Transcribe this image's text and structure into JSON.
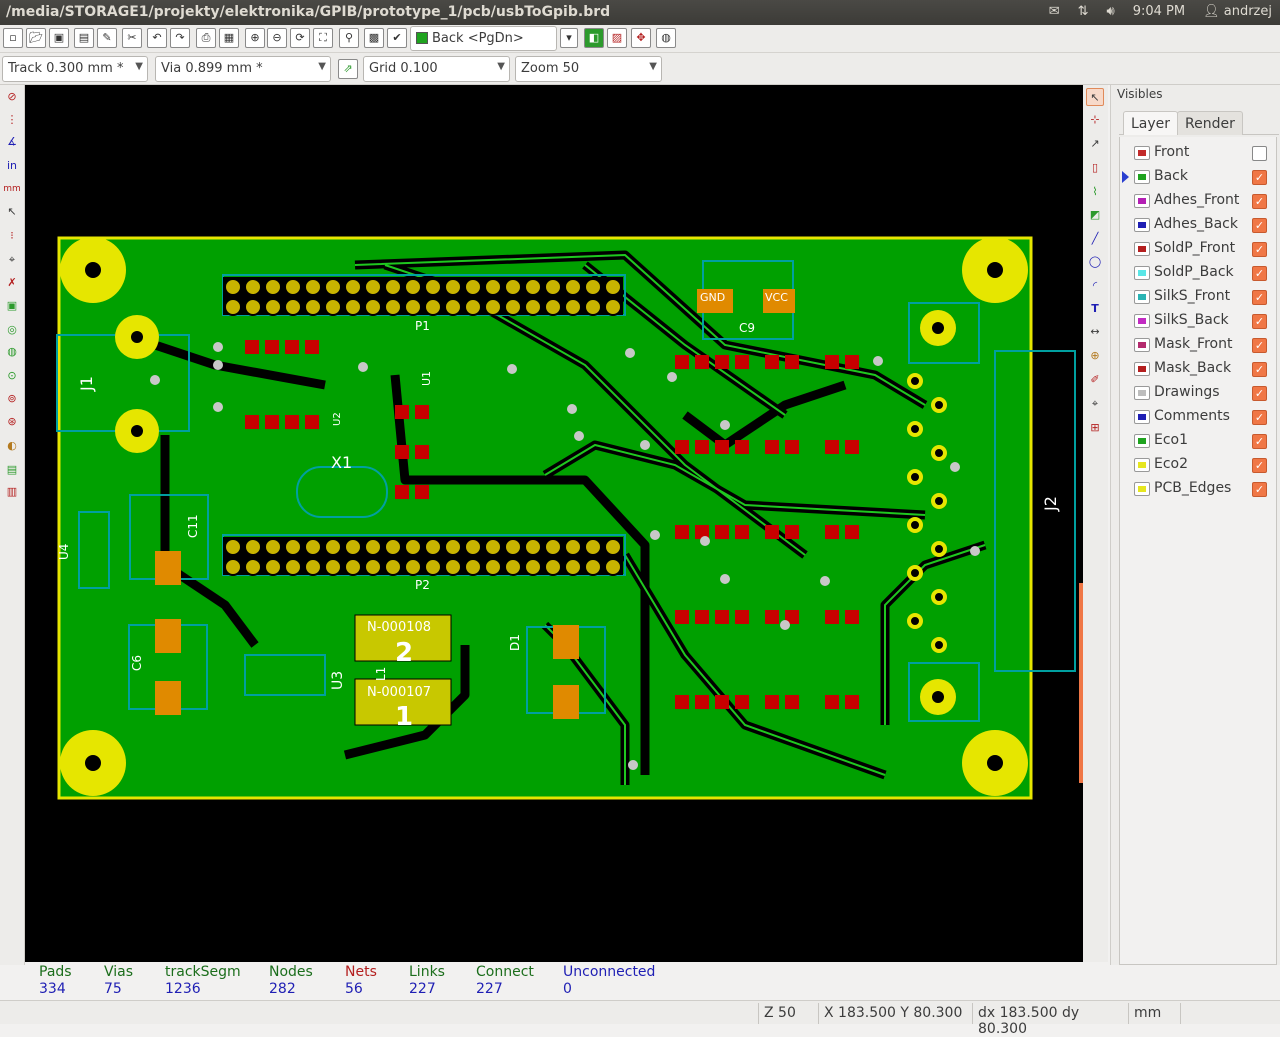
{
  "window": {
    "title": "/media/STORAGE1/projekty/elektronika/GPIB/prototype_1/pcb/usbToGpib.brd"
  },
  "tray": {
    "time": "9:04 PM",
    "user": "andrzej"
  },
  "toolbar": {
    "layer_select": "Back <PgDn>"
  },
  "options": {
    "track": "Track 0.300 mm *",
    "via": "Via 0.899 mm *",
    "grid": "Grid 0.100",
    "zoom": "Zoom 50"
  },
  "visibles": {
    "title": "Visibles",
    "tabs": [
      "Layer",
      "Render"
    ],
    "layers": [
      {
        "name": "Front",
        "color": "#c22b2b",
        "checked": false,
        "current": false
      },
      {
        "name": "Back",
        "color": "#1fa31f",
        "checked": true,
        "current": true
      },
      {
        "name": "Adhes_Front",
        "color": "#b41fb4",
        "checked": true,
        "current": false
      },
      {
        "name": "Adhes_Back",
        "color": "#1f1fb4",
        "checked": true,
        "current": false
      },
      {
        "name": "SoldP_Front",
        "color": "#b41f1f",
        "checked": true,
        "current": false
      },
      {
        "name": "SoldP_Back",
        "color": "#5ae6e6",
        "checked": true,
        "current": false
      },
      {
        "name": "SilkS_Front",
        "color": "#2ab4b4",
        "checked": true,
        "current": false
      },
      {
        "name": "SilkS_Back",
        "color": "#c22bc2",
        "checked": true,
        "current": false
      },
      {
        "name": "Mask_Front",
        "color": "#b42b6e",
        "checked": true,
        "current": false
      },
      {
        "name": "Mask_Back",
        "color": "#b41f1f",
        "checked": true,
        "current": false
      },
      {
        "name": "Drawings",
        "color": "#bdbdbd",
        "checked": true,
        "current": false
      },
      {
        "name": "Comments",
        "color": "#1f1fb4",
        "checked": true,
        "current": false
      },
      {
        "name": "Eco1",
        "color": "#1fa31f",
        "checked": true,
        "current": false
      },
      {
        "name": "Eco2",
        "color": "#e6e61f",
        "checked": true,
        "current": false
      },
      {
        "name": "PCB_Edges",
        "color": "#e6e61f",
        "checked": true,
        "current": false
      }
    ]
  },
  "stats": [
    {
      "label": "Pads",
      "value": "334",
      "color": "#1c6e1c"
    },
    {
      "label": "Vias",
      "value": "75",
      "color": "#1c6e1c"
    },
    {
      "label": "trackSegm",
      "value": "1236",
      "color": "#1c6e1c"
    },
    {
      "label": "Nodes",
      "value": "282",
      "color": "#1c6e1c"
    },
    {
      "label": "Nets",
      "value": "56",
      "color": "#b41f1f"
    },
    {
      "label": "Links",
      "value": "227",
      "color": "#1c6e1c"
    },
    {
      "label": "Connect",
      "value": "227",
      "color": "#1c6e1c"
    },
    {
      "label": "Unconnected",
      "value": "0",
      "color": "#1f1fb4"
    }
  ],
  "status": {
    "zoom": "Z 50",
    "xy": "X 183.500  Y 80.300",
    "dxy": "dx 183.500  dy 80.300",
    "units": "mm"
  },
  "board": {
    "labels": {
      "j1": "J1",
      "j2": "J2",
      "x1": "X1",
      "u3": "U3",
      "u4": "U4",
      "p1": "P1",
      "p2": "P2",
      "c9": "C9",
      "c6": "C6",
      "c11": "C11",
      "l1": "L1",
      "d1": "D1",
      "u1": "U1",
      "u2": "U2",
      "pad2": "2",
      "pad1": "1",
      "net2": "N-000108",
      "net1": "N-000107",
      "gnd": "GND",
      "vcc": "VCC"
    },
    "colors": {
      "copper_back": "#00a000",
      "copper_front": "#c80000",
      "edge": "#e6e600",
      "silk": "#00a0a0"
    }
  }
}
